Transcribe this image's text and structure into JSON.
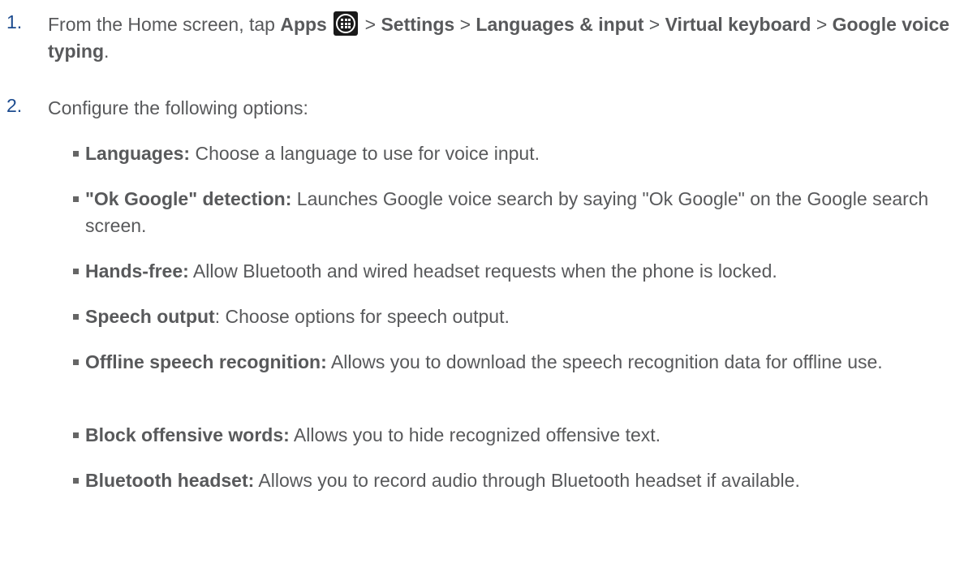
{
  "steps": [
    {
      "number": "1.",
      "intro": "From the Home screen, tap ",
      "apps": "Apps",
      "sep1": " > ",
      "settings": "Settings",
      "sep2": " > ",
      "languages_input": "Languages & input",
      "sep3": " > ",
      "virtual_keyboard": "Virtual keyboard",
      "sep4": " > ",
      "google_voice_typing": "Google voice typing",
      "end": ".",
      "icon": "apps-grid-icon"
    },
    {
      "number": "2.",
      "text": "Configure the following options:"
    }
  ],
  "options": [
    {
      "term": "Languages:",
      "desc": " Choose a language to use for voice input."
    },
    {
      "term": "\"Ok Google\" detection:",
      "desc": " Launches Google voice search by saying \"Ok Google\" on the Google search screen."
    },
    {
      "term": "Hands-free:",
      "desc": " Allow Bluetooth and wired headset requests when the phone is locked."
    },
    {
      "term": "Speech output",
      "desc": ": Choose options for speech output."
    },
    {
      "term": "Offline speech recognition:",
      "desc": " Allows you to download the speech recognition data for offline use."
    },
    {
      "term": "Block offensive words:",
      "desc": " Allows you to hide recognized offensive text."
    },
    {
      "term": "Bluetooth headset:",
      "desc": " Allows you to record audio through Bluetooth headset if available."
    }
  ],
  "colors": {
    "text": "#58595b",
    "step_number": "#1c4b8f",
    "bullet": "#666666"
  }
}
